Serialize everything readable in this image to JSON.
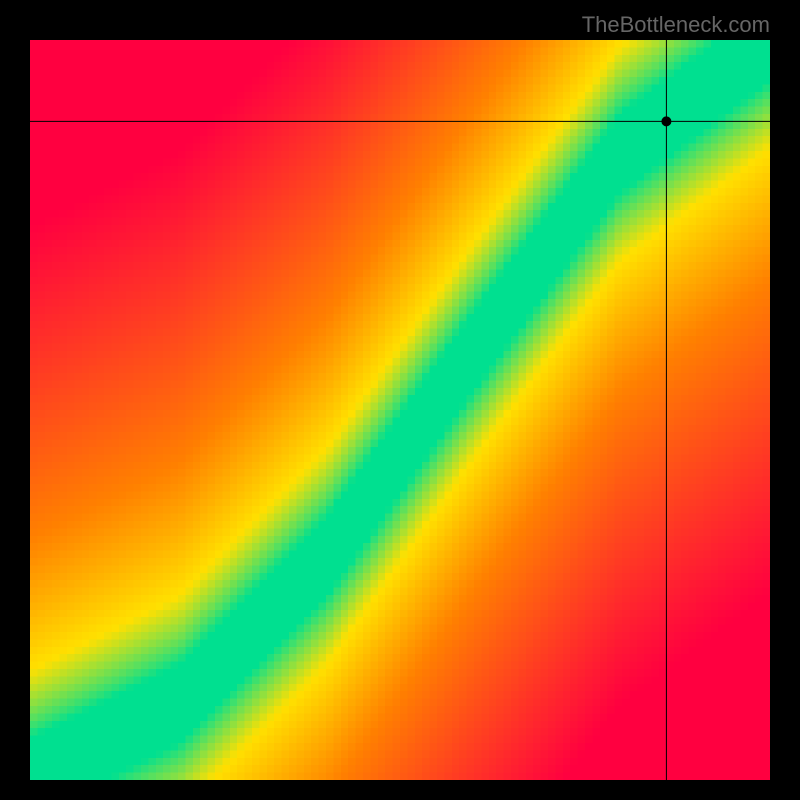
{
  "watermark": "TheBottleneck.com",
  "colors": {
    "background": "#000000",
    "heat_low": "#ff0040",
    "heat_mid1": "#ff8000",
    "heat_mid2": "#ffe000",
    "heat_high": "#00e090",
    "crosshair": "#000000",
    "marker": "#000000"
  },
  "chart_data": {
    "type": "heatmap",
    "title": "",
    "xlabel": "",
    "ylabel": "",
    "xlim": [
      0,
      100
    ],
    "ylim": [
      0,
      100
    ],
    "grid_size": 100,
    "optimal_curve_control_points": [
      {
        "x": 0,
        "y": 0
      },
      {
        "x": 20,
        "y": 10
      },
      {
        "x": 40,
        "y": 30
      },
      {
        "x": 60,
        "y": 58
      },
      {
        "x": 80,
        "y": 85
      },
      {
        "x": 100,
        "y": 100
      }
    ],
    "band_halfwidth": 6,
    "marker": {
      "x": 86,
      "y": 89
    },
    "crosshair": {
      "x": 86,
      "y": 89
    }
  }
}
